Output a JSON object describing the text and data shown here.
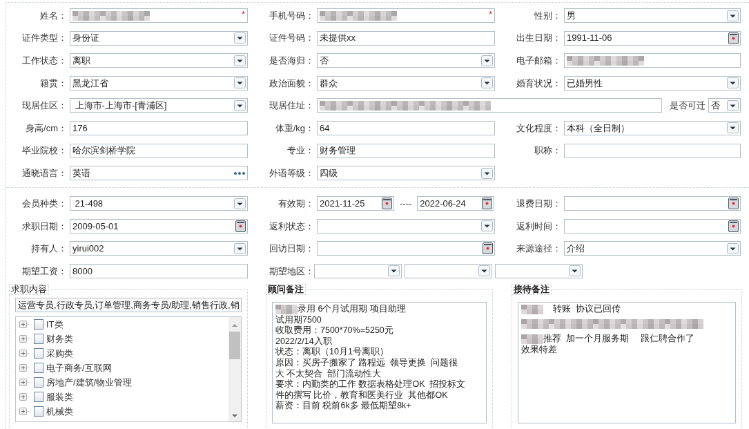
{
  "personal_section": {
    "rows": [
      [
        {
          "label": "姓名：",
          "kind": "text",
          "redacted": true,
          "marker": "*"
        },
        {
          "label": "手机号码：",
          "kind": "text",
          "redacted": true,
          "marker": "*"
        },
        {
          "label": "性别：",
          "kind": "select",
          "value": "男"
        }
      ],
      [
        {
          "label": "证件类型：",
          "kind": "select",
          "value": "身份证"
        },
        {
          "label": "证件号码：",
          "kind": "text",
          "value": "未提供xx"
        },
        {
          "label": "出生日期：",
          "kind": "date",
          "value": "1991-11-06"
        }
      ],
      [
        {
          "label": "工作状态：",
          "kind": "select",
          "value": "离职"
        },
        {
          "label": "是否海归：",
          "kind": "select",
          "value": "否"
        },
        {
          "label": "电子邮箱：",
          "kind": "text",
          "redacted": true
        }
      ],
      [
        {
          "label": "籍贯：",
          "kind": "select",
          "value": "黑龙江省"
        },
        {
          "label": "政治面貌：",
          "kind": "select",
          "value": "群众"
        },
        {
          "label": "婚育状况：",
          "kind": "select",
          "value": "已婚男性"
        }
      ],
      [
        {
          "label": "现居住区：",
          "kind": "select",
          "value": " 上海市-上海市-[青浦区]"
        },
        {
          "label": "现居住址：",
          "kind": "text",
          "redacted": true,
          "suffix": {
            "label": "是否可迁",
            "kind": "select",
            "value": "否"
          }
        }
      ],
      [
        {
          "label": "身高/cm：",
          "kind": "text",
          "value": "176"
        },
        {
          "label": "体重/kg：",
          "kind": "text",
          "value": "64"
        },
        {
          "label": "文化程度：",
          "kind": "select",
          "value": "本科（全日制）"
        }
      ],
      [
        {
          "label": "毕业院校：",
          "kind": "text",
          "value": "哈尔滨剑桥学院"
        },
        {
          "label": "专业：",
          "kind": "text",
          "value": "财务管理"
        },
        {
          "label": "职称：",
          "kind": "text"
        }
      ],
      [
        {
          "label": "通晓语言：",
          "kind": "more",
          "value": "英语"
        },
        {
          "label": "外语等级：",
          "kind": "select",
          "value": "四级"
        }
      ]
    ]
  },
  "membership_section": {
    "rows": [
      [
        {
          "label": "会员种类：",
          "kind": "select",
          "value": " 21-498"
        },
        {
          "label": "有效期：",
          "kind": "daterange",
          "from": "2021-11-25",
          "separator": "----",
          "to": "2022-06-24"
        },
        {
          "label": "退费日期：",
          "kind": "date"
        }
      ],
      [
        {
          "label": "求职日期：",
          "kind": "date",
          "value": "2009-05-01"
        },
        {
          "label": "返利状态：",
          "kind": "select"
        },
        {
          "label": "返利时间：",
          "kind": "date"
        }
      ],
      [
        {
          "label": "持有人：",
          "kind": "select",
          "value": "yirui002"
        },
        {
          "label": "回访日期：",
          "kind": "date"
        },
        {
          "label": "来源途径：",
          "kind": "select",
          "value": "介绍"
        }
      ],
      [
        {
          "label": "期望工资：",
          "kind": "text",
          "value": "8000"
        },
        {
          "label": "期望地区：",
          "kind": "multiselect",
          "dropdowns": [
            {
              "kind": "select"
            },
            {
              "kind": "select"
            },
            {
              "kind": "select"
            }
          ]
        }
      ]
    ]
  },
  "job_content": {
    "title": "求职内容",
    "summary": "运营专员,行政专员,订单管理,商务专员/助理,销售行政,销",
    "tree": [
      {
        "label": "IT类",
        "checked": false,
        "expanded": false
      },
      {
        "label": "财务类",
        "checked": false,
        "expanded": false
      },
      {
        "label": "采购类",
        "checked": false,
        "expanded": false
      },
      {
        "label": "电子商务/互联网",
        "checked": false,
        "expanded": false
      },
      {
        "label": "房地产/建筑/物业管理",
        "checked": false,
        "expanded": false
      },
      {
        "label": "服装类",
        "checked": false,
        "expanded": false
      },
      {
        "label": "机械类",
        "checked": false,
        "expanded": false
      }
    ]
  },
  "consultant_notes": {
    "title": "顾问备注",
    "lines": [
      {
        "redacted": true,
        "text": "录用 6个月试用期 项目助理"
      },
      {
        "text": "试用期7500"
      },
      {
        "text": "收取费用：7500*70%=5250元"
      },
      {
        "text": "2022/2/14入职"
      },
      {
        "text": "状态：离职（10月1号离职）"
      },
      {
        "text": "原因：买房子搬家了 路程远  领导更换  问题很"
      },
      {
        "text": "大 不太契合  部门流动性大"
      },
      {
        "text": "要求：内勤类的工作 数据表格处理OK  招投标文"
      },
      {
        "text": "件的撰写 比价，教育和医美行业  其他都OK"
      },
      {
        "text": "薪资：目前 税前6k多 最低期望8k+"
      }
    ]
  },
  "reception_notes": {
    "title": "接待备注",
    "lines": [
      {
        "redacted": true,
        "text": "    转账  协议已回传"
      },
      {
        "redacted": true
      },
      {
        "redacted": true,
        "text": "推荐  加一个月服务期     跟仁聘合作了"
      },
      {
        "text": "效果特差"
      }
    ]
  }
}
